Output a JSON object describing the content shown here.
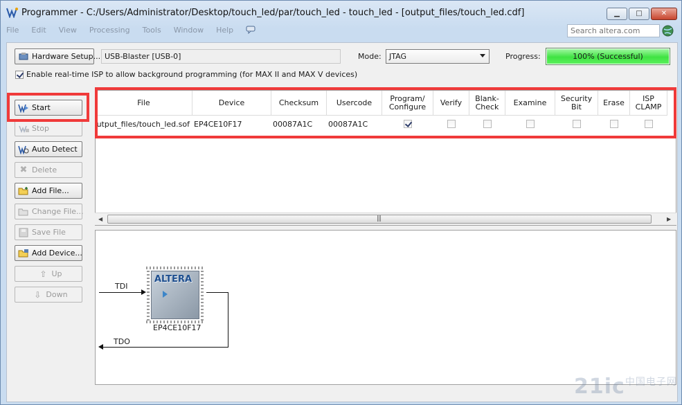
{
  "window": {
    "title": "Programmer - C:/Users/Administrator/Desktop/touch_led/par/touch_led - touch_led - [output_files/touch_led.cdf]"
  },
  "menu": [
    "File",
    "Edit",
    "View",
    "Processing",
    "Tools",
    "Window",
    "Help"
  ],
  "search": {
    "placeholder": "Search altera.com"
  },
  "hardware": {
    "setup_label": "Hardware Setup...",
    "device": "USB-Blaster [USB-0]"
  },
  "mode": {
    "label": "Mode:",
    "value": "JTAG"
  },
  "progress": {
    "label": "Progress:",
    "percent": 100,
    "text": "100% (Successful)"
  },
  "isp": {
    "label": "Enable real-time ISP to allow background programming (for MAX II and MAX V devices)",
    "checked": true
  },
  "sidebar": {
    "start": "Start",
    "stop": "Stop",
    "auto_detect": "Auto Detect",
    "delete": "Delete",
    "add_file": "Add File...",
    "change_file": "Change File...",
    "save_file": "Save File",
    "add_device": "Add Device...",
    "up": "Up",
    "down": "Down"
  },
  "table": {
    "columns": [
      "File",
      "Device",
      "Checksum",
      "Usercode",
      "Program/\nConfigure",
      "Verify",
      "Blank-\nCheck",
      "Examine",
      "Security\nBit",
      "Erase",
      "ISP\nCLAMP"
    ],
    "rows": [
      {
        "file": "output_files/touch_led.sof",
        "device": "EP4CE10F17",
        "checksum": "00087A1C",
        "usercode": "00087A1C",
        "program": true,
        "verify": false,
        "blank_check": false,
        "examine": false,
        "security_bit": false,
        "erase": false,
        "isp_clamp": false
      }
    ]
  },
  "chain": {
    "tdi": "TDI",
    "tdo": "TDO",
    "chip_logo": "ALTERA",
    "chip_name": "EP4CE10F17"
  },
  "watermark": {
    "main": "21ic",
    "sub": "中国电子网"
  },
  "colors": {
    "highlight": "#f03a3a",
    "progress": "#3fe342"
  }
}
